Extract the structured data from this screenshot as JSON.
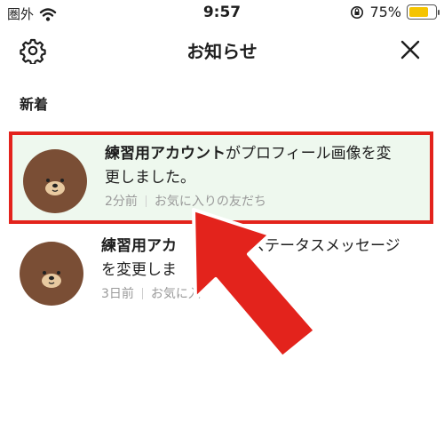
{
  "status_bar": {
    "carrier": "圏外",
    "time": "9:57",
    "battery_percent": "75%",
    "battery_level": 0.75
  },
  "header": {
    "title": "お知らせ",
    "settings_icon": "gear-icon",
    "close_icon": "close-icon"
  },
  "section": {
    "label": "新着"
  },
  "notifications": [
    {
      "name": "練習用アカウント",
      "message_line1": "がプロフィール画像を変",
      "message_line2": "更しました。",
      "time": "2分前",
      "category": "お気に入りの友だち"
    },
    {
      "name": "練習用アカ",
      "message_line1": "ステータスメッセージ",
      "message_line2": "を変更しま",
      "time": "3日前",
      "category_part1": "お気に入",
      "category_part2": "ち"
    }
  ],
  "colors": {
    "highlight_border": "#e3231c",
    "highlight_bg": "#eef8ee",
    "arrow": "#e3231c",
    "battery": "#f5c400",
    "avatar": "#7a4e35"
  }
}
